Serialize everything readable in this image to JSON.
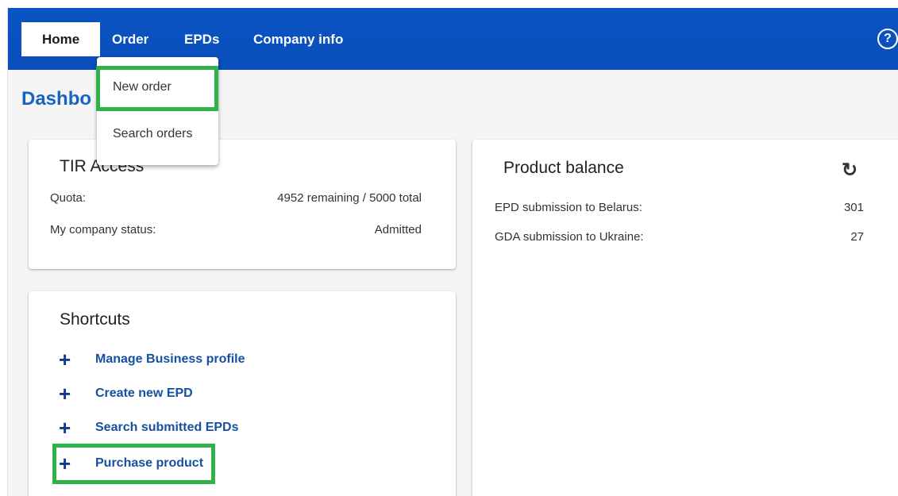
{
  "nav": {
    "home": "Home",
    "order": "Order",
    "epds": "EPDs",
    "company_info": "Company info",
    "help": "?"
  },
  "order_menu": {
    "new_order": "New order",
    "search_orders": "Search orders"
  },
  "page_title": "Dashbo",
  "tir_access": {
    "title": "TIR Access",
    "quota_label": "Quota:",
    "quota_value": "4952 remaining / 5000 total",
    "status_label": "My company status:",
    "status_value": "Admitted"
  },
  "product_balance": {
    "title": "Product balance",
    "refresh": "↻",
    "items": [
      {
        "label": "EPD submission to Belarus:",
        "value": "301"
      },
      {
        "label": "GDA submission to Ukraine:",
        "value": "27"
      }
    ]
  },
  "shortcuts": {
    "title": "Shortcuts",
    "plus": "+",
    "items": [
      {
        "label": "Manage Business profile"
      },
      {
        "label": "Create new EPD"
      },
      {
        "label": "Search submitted EPDs"
      },
      {
        "label": "Purchase product"
      }
    ]
  },
  "colors": {
    "navbar": "#0a4ebb",
    "accent": "#1565c0",
    "highlight": "#2db34a"
  }
}
